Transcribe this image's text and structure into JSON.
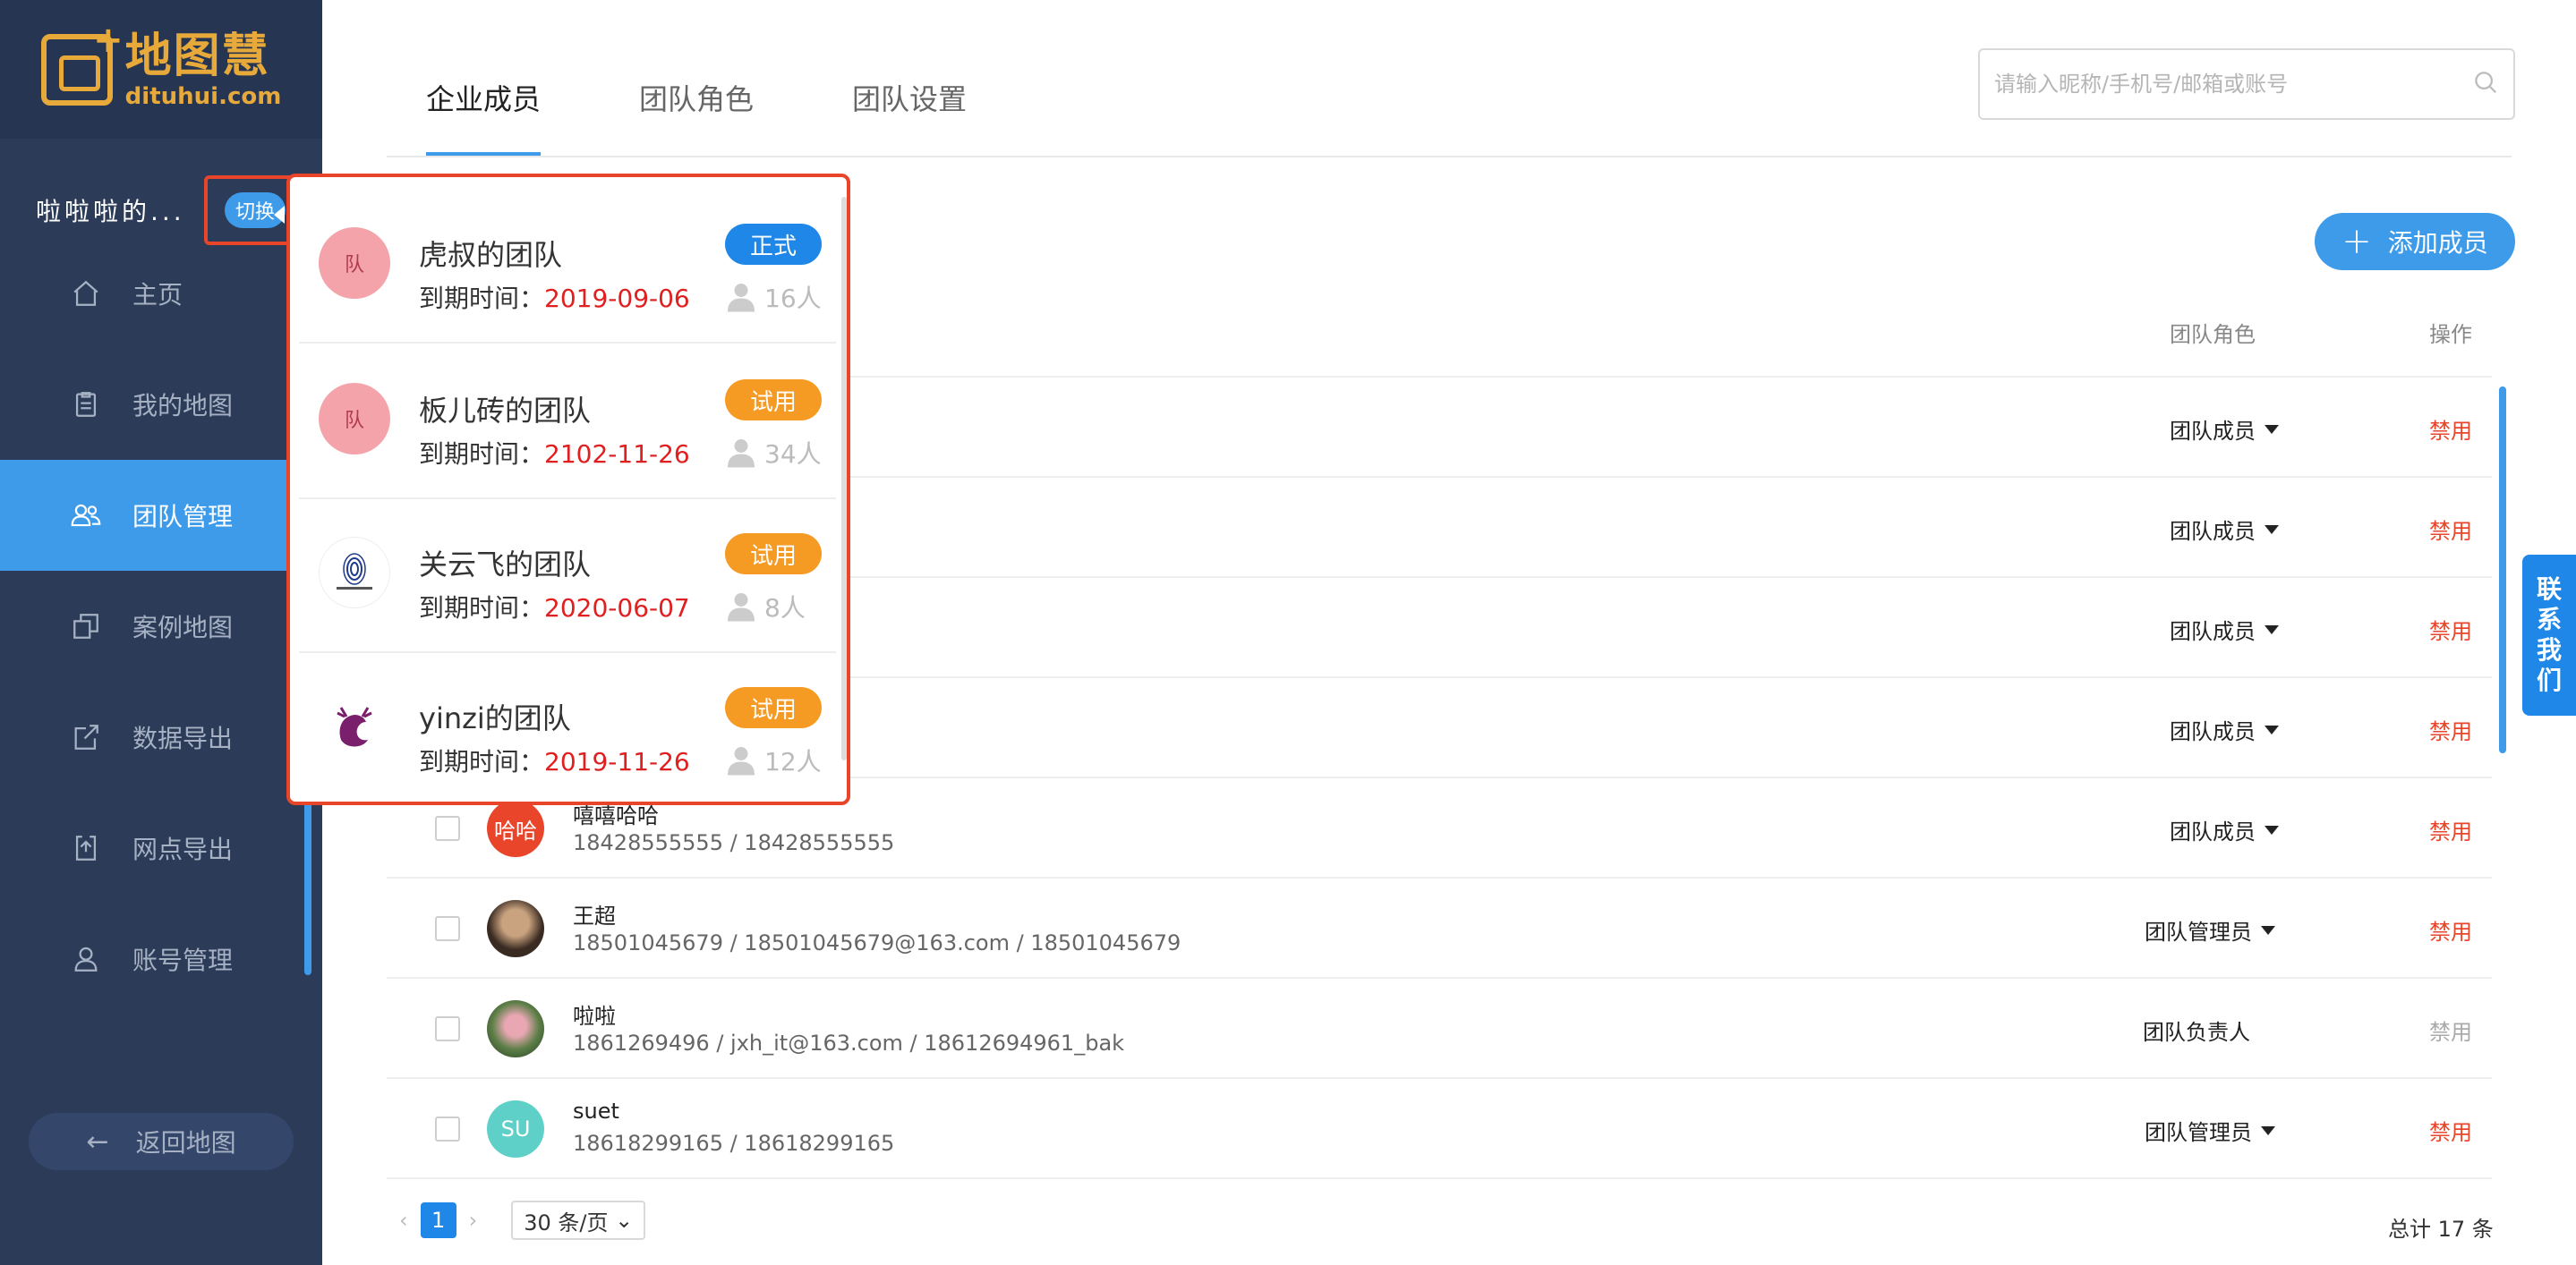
{
  "logo": {
    "cn": "地图慧",
    "en": "dituhui.com"
  },
  "team": {
    "name": "啦啦啦的...",
    "switch_label": "切换"
  },
  "nav": [
    {
      "label": "主页",
      "icon": "home-icon"
    },
    {
      "label": "我的地图",
      "icon": "clipboard-icon"
    },
    {
      "label": "团队管理",
      "icon": "users-icon",
      "active": true
    },
    {
      "label": "案例地图",
      "icon": "copy-icon"
    },
    {
      "label": "数据导出",
      "icon": "export-icon"
    },
    {
      "label": "网点导出",
      "icon": "share-icon"
    },
    {
      "label": "账号管理",
      "icon": "user-icon"
    }
  ],
  "back_button": "返回地图",
  "tabs": [
    "企业成员",
    "团队角色",
    "团队设置"
  ],
  "search": {
    "placeholder": "请输入昵称/手机号/邮箱或账号"
  },
  "add_button": "添加成员",
  "table": {
    "headers": {
      "role": "团队角色",
      "op": "操作"
    },
    "rows": [
      {
        "name": "",
        "contact": "",
        "role": "团队成员",
        "op": "禁用"
      },
      {
        "name": "",
        "contact": "",
        "role": "团队成员",
        "op": "禁用"
      },
      {
        "name": "",
        "contact": "",
        "role": "团队成员",
        "op": "禁用"
      },
      {
        "name": "",
        "contact": "",
        "role": "团队成员",
        "op": "禁用"
      },
      {
        "name": "嘻嘻哈哈",
        "contact": "18428555555 / 18428555555",
        "role": "团队成员",
        "op": "禁用",
        "avatar_text": "哈哈",
        "avatar_color": "#e8452b"
      },
      {
        "name": "王超",
        "contact": "18501045679 / 18501045679@163.com / 18501045679",
        "role": "团队管理员",
        "op": "禁用",
        "avatar_color": "#5a4a3a"
      },
      {
        "name": "啦啦",
        "contact": "1861269496 / jxh_it@163.com / 18612694961_bak",
        "role": "团队负责人",
        "op": "禁用",
        "avatar_color": "#6f8f5a"
      },
      {
        "name": "suet",
        "contact": "18618299165 / 18618299165",
        "role": "团队管理员",
        "op": "禁用",
        "avatar_text": "SU",
        "avatar_color": "#5ed0c8"
      }
    ]
  },
  "pagination": {
    "page": "1",
    "page_size": "30 条/页",
    "total": "总计 17 条"
  },
  "dropdown": [
    {
      "name": "虎叔的团队",
      "exp_label": "到期时间：",
      "exp_date": "2019-09-06",
      "badge": "正式",
      "count": "16人",
      "avatar_text": "队",
      "avatar_color": "#f4a3aa"
    },
    {
      "name": "板儿砖的团队",
      "exp_label": "到期时间：",
      "exp_date": "2102-11-26",
      "badge": "试用",
      "count": "34人",
      "avatar_text": "队",
      "avatar_color": "#f4a3aa"
    },
    {
      "name": "关云飞的团队",
      "exp_label": "到期时间：",
      "exp_date": "2020-06-07",
      "badge": "试用",
      "count": "8人",
      "avatar_text": "",
      "avatar_color": "#ffffff"
    },
    {
      "name": "yinzi的团队",
      "exp_label": "到期时间：",
      "exp_date": "2019-11-26",
      "badge": "试用",
      "count": "12人",
      "avatar_text": "",
      "avatar_color": "#ffffff"
    }
  ],
  "contact_us": [
    "联",
    "系",
    "我",
    "们"
  ],
  "colors": {
    "accent": "#3d9be9",
    "sidebar": "#2c3b57",
    "danger": "#e02020",
    "trial": "#f59a23",
    "highlight": "#e8452b"
  }
}
